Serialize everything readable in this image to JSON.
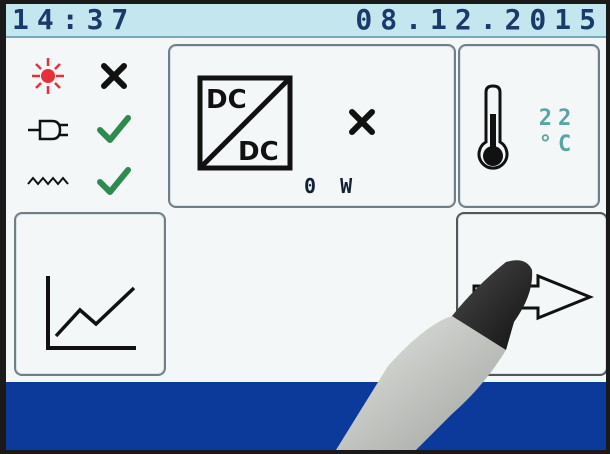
{
  "status_bar": {
    "time": "14:37",
    "date": "08.12.2015"
  },
  "status_rows": [
    {
      "icon": "sun-icon",
      "state_icon": "cross-icon"
    },
    {
      "icon": "power-plug-icon",
      "state_icon": "checkmark-icon"
    },
    {
      "icon": "ac-wave-icon",
      "state_icon": "checkmark-icon"
    }
  ],
  "dcdc": {
    "label_top": "DC",
    "label_bottom": "DC",
    "state_icon": "cross-icon",
    "power": "0 W"
  },
  "temperature": {
    "icon": "thermometer-icon",
    "value": "22",
    "unit": "°C"
  },
  "graph_button": {
    "icon": "line-graph-icon"
  },
  "next_button": {
    "icon": "arrow-right-icon"
  },
  "colors": {
    "topbar_bg": "#c4e6ef",
    "topbar_text": "#1a3a6a",
    "sun": "#e8303a",
    "check": "#2e8a4e",
    "temp_text": "#5aa4a6",
    "bottombar": "#0c3a9a"
  }
}
